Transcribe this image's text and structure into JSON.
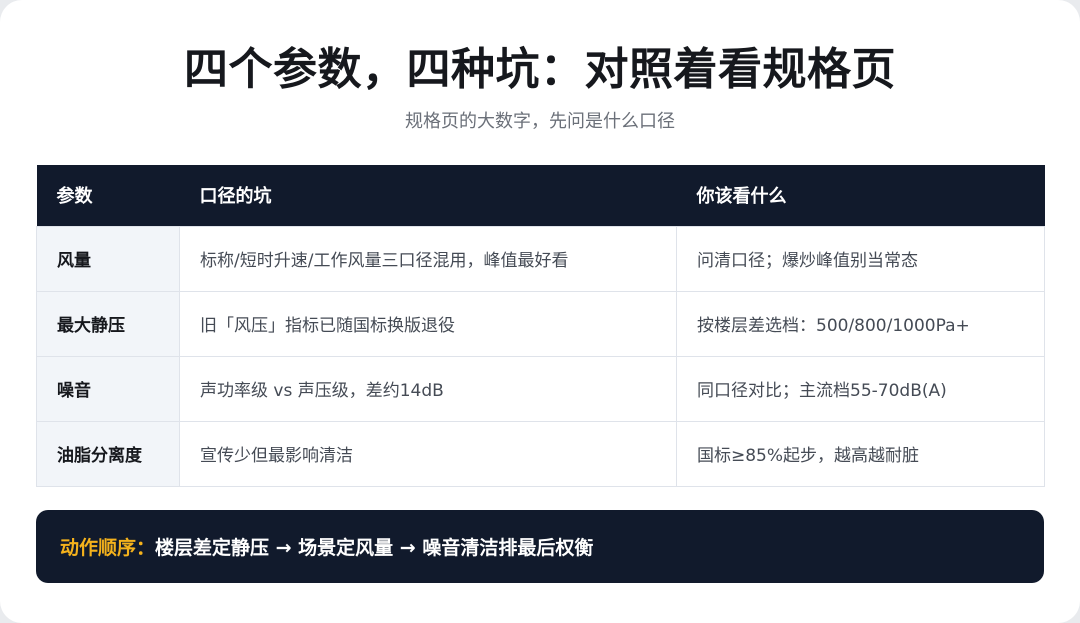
{
  "header": {
    "title": "四个参数，四种坑：对照着看规格页",
    "subtitle": "规格页的大数字，先问是什么口径"
  },
  "table": {
    "columns": [
      "参数",
      "口径的坑",
      "你该看什么"
    ],
    "rows": [
      {
        "param": "风量",
        "pitfall": "标称/短时升速/工作风量三口径混用，峰值最好看",
        "advice": "问清口径；爆炒峰值别当常态"
      },
      {
        "param": "最大静压",
        "pitfall": "旧「风压」指标已随国标换版退役",
        "advice": "按楼层差选档：500/800/1000Pa+"
      },
      {
        "param": "噪音",
        "pitfall": "声功率级 vs 声压级，差约14dB",
        "advice": "同口径对比；主流档55-70dB(A)"
      },
      {
        "param": "油脂分离度",
        "pitfall": "宣传少但最影响清洁",
        "advice": "国标≥85%起步，越高越耐脏"
      }
    ]
  },
  "action": {
    "label": "动作顺序：",
    "text": "楼层差定静压 → 场景定风量 → 噪音清洁排最后权衡"
  },
  "colors": {
    "header_bg": "#111a2c",
    "accent": "#f5b21c"
  }
}
